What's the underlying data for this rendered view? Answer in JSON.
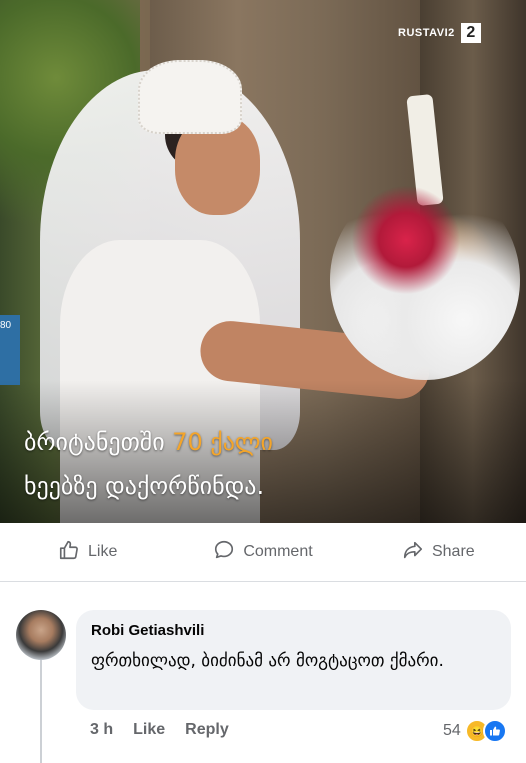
{
  "post": {
    "caption_line1_pre": "ბრიტანეთში ",
    "caption_line1_highlight": "70 ქალი",
    "caption_line2": "ხეებზე დაქორწინდა.",
    "watermark": "RUSTAVI2",
    "watermark_badge": "2",
    "sign_text": "80"
  },
  "actions": {
    "like": "Like",
    "comment": "Comment",
    "share": "Share"
  },
  "comment": {
    "author": "Robi Getiashvili",
    "text": "ფრთხილად, ბიძინამ არ მოგტაცოთ ქმარი.",
    "time": "3 h",
    "like": "Like",
    "reply": "Reply",
    "reaction_count": "54"
  },
  "colors": {
    "highlight": "#f4a52a",
    "meta_gray": "#65676b",
    "bubble": "#f0f2f5",
    "like_blue": "#1877f2"
  }
}
